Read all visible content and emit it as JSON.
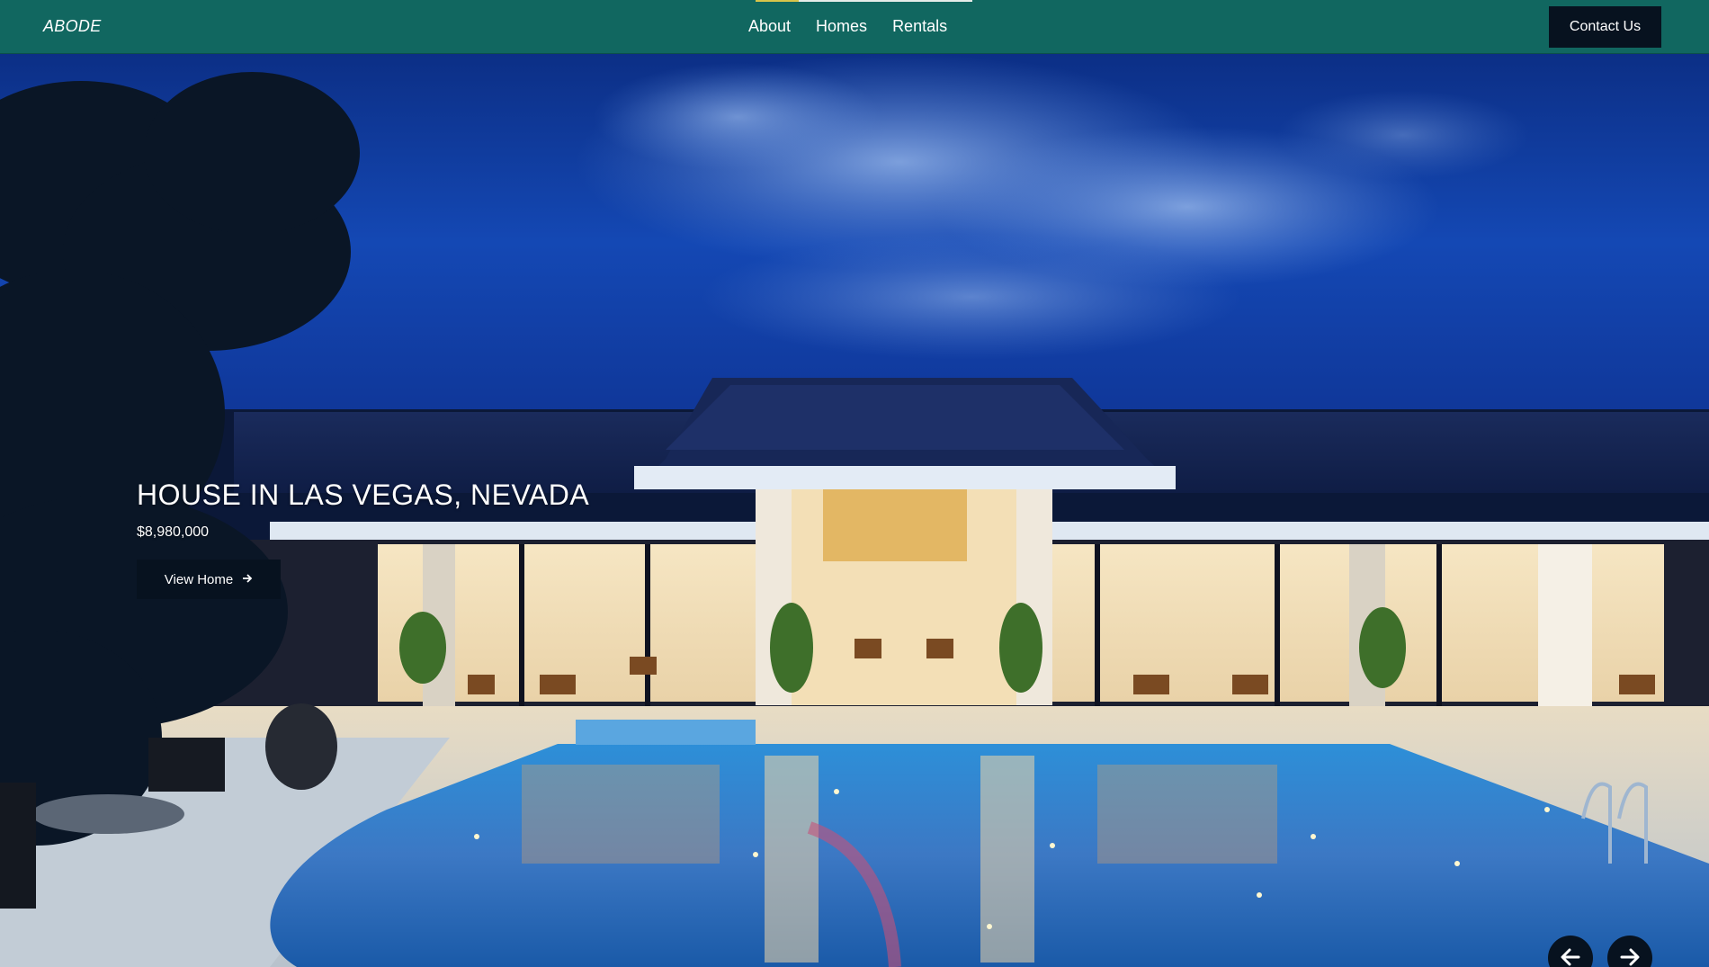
{
  "nav": {
    "logo": "ABODE",
    "links": [
      "About",
      "Homes",
      "Rentals"
    ],
    "contact_label": "Contact Us"
  },
  "hero": {
    "title": "HOUSE IN LAS VEGAS, NEVADA",
    "price": "$8,980,000",
    "cta_label": "View Home",
    "cta_icon": "arrow-right-icon",
    "prev_icon": "arrow-left-icon",
    "next_icon": "arrow-right-icon"
  },
  "colors": {
    "navbar": "#116760",
    "button_dark": "#07121f",
    "accent_indicator": "#d8c44a"
  }
}
